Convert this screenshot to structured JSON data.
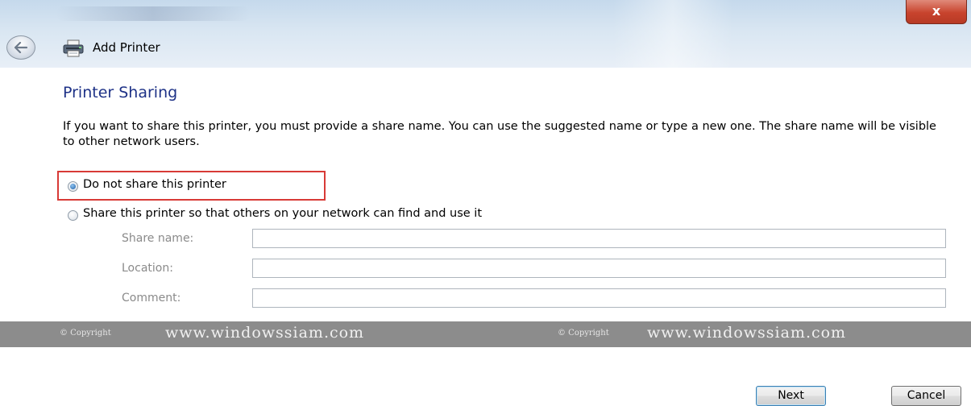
{
  "window": {
    "title": "Add Printer",
    "close_label": "x"
  },
  "page": {
    "heading": "Printer Sharing",
    "description": "If you want to share this printer, you must provide a share name. You can use the suggested name or type a new one. The share name will be visible to other network users."
  },
  "options": [
    {
      "label": "Do not share this printer",
      "selected": true
    },
    {
      "label": "Share this printer so that others on your network can find and use it",
      "selected": false
    }
  ],
  "fields": [
    {
      "label": "Share name:",
      "value": ""
    },
    {
      "label": "Location:",
      "value": ""
    },
    {
      "label": "Comment:",
      "value": ""
    }
  ],
  "watermark": {
    "copyright": "© Copyright",
    "site": "www.windowssiam.com"
  },
  "buttons": {
    "next": "Next",
    "cancel": "Cancel"
  },
  "colors": {
    "heading": "#1e3287",
    "highlight": "#d83a36",
    "watermark_bar": "#8c8c8c"
  }
}
